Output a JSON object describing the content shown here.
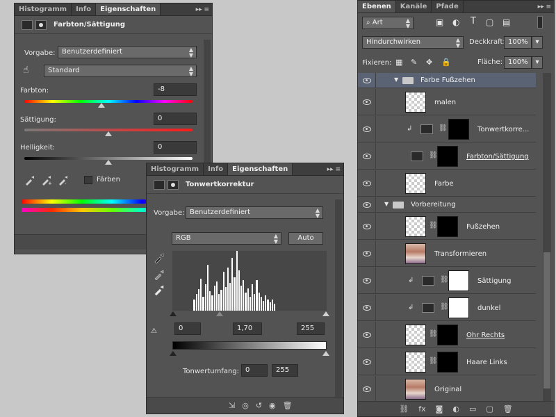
{
  "panel_hue": {
    "tabs": [
      "Histogramm",
      "Info",
      "Eigenschaften"
    ],
    "title": "Farbton/Sättigung",
    "preset_label": "Vorgabe:",
    "preset_value": "Benutzerdefiniert",
    "channel_value": "Standard",
    "hue_label": "Farbton:",
    "hue_value": "-8",
    "sat_label": "Sättigung:",
    "sat_value": "0",
    "light_label": "Helligkeit:",
    "light_value": "0",
    "colorize_label": "Färben"
  },
  "panel_levels": {
    "tabs": [
      "Histogramm",
      "Info",
      "Eigenschaften"
    ],
    "title": "Tonwertkorrektur",
    "preset_label": "Vorgabe:",
    "preset_value": "Benutzerdefiniert",
    "channel_value": "RGB",
    "auto_label": "Auto",
    "input_black": "0",
    "input_gamma": "1,70",
    "input_white": "255",
    "output_label": "Tonwertumfang:",
    "output_black": "0",
    "output_white": "255"
  },
  "panel_layers": {
    "tabs": [
      "Ebenen",
      "Kanäle",
      "Pfade"
    ],
    "filter_value": "Art",
    "blend_mode": "Hindurchwirken",
    "opacity_label": "Deckkraft:",
    "opacity_value": "100%",
    "lock_label": "Fixieren:",
    "fill_label": "Fläche:",
    "fill_value": "100%",
    "layers": [
      {
        "name": "Farbe Fußzehen"
      },
      {
        "name": "malen"
      },
      {
        "name": "Tonwertkorre..."
      },
      {
        "name": "Farbton/Sättigung"
      },
      {
        "name": "Farbe"
      },
      {
        "name": "Vorbereitung"
      },
      {
        "name": "Fußzehen"
      },
      {
        "name": "Transformieren"
      },
      {
        "name": "Sättigung"
      },
      {
        "name": "dunkel"
      },
      {
        "name": "Ohr Rechts"
      },
      {
        "name": "Haare Links"
      },
      {
        "name": "Original"
      }
    ]
  },
  "colors": {
    "panel_bg": "#535353",
    "selected_row": "#596374",
    "canvas_bg": "#c8c8c8"
  }
}
